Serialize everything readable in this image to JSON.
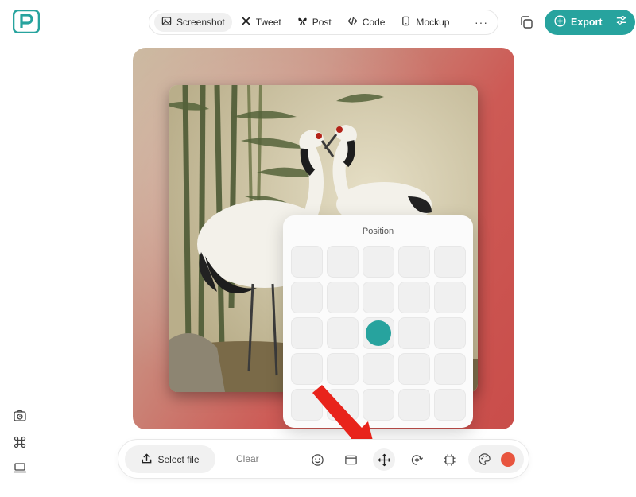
{
  "nav": {
    "tabs": [
      {
        "label": "Screenshot",
        "icon": "image-icon",
        "active": true
      },
      {
        "label": "Tweet",
        "icon": "x-icon"
      },
      {
        "label": "Post",
        "icon": "butterfly-icon"
      },
      {
        "label": "Code",
        "icon": "code-icon"
      },
      {
        "label": "Mockup",
        "icon": "phone-icon"
      }
    ],
    "more": "···"
  },
  "export": {
    "label": "Export"
  },
  "position_popup": {
    "title": "Position",
    "grid": {
      "rows": 5,
      "cols": 5,
      "selected": [
        2,
        2
      ]
    }
  },
  "toolbar": {
    "select_file": "Select file",
    "clear": "Clear",
    "tools": [
      "emoji-icon",
      "window-frame-icon",
      "move-icon",
      "rotate-3d-icon",
      "crop-frame-icon"
    ],
    "active_tool": "move-icon",
    "selected_color": "#e8553f"
  },
  "colors": {
    "accent": "#27a39e",
    "annotation_arrow": "#e8231b",
    "canvas_gradient_start": "#c9b79d",
    "canvas_gradient_end": "#c94d4a"
  },
  "sidebar_icons": [
    "camera-timer-icon",
    "command-icon",
    "laptop-icon"
  ]
}
